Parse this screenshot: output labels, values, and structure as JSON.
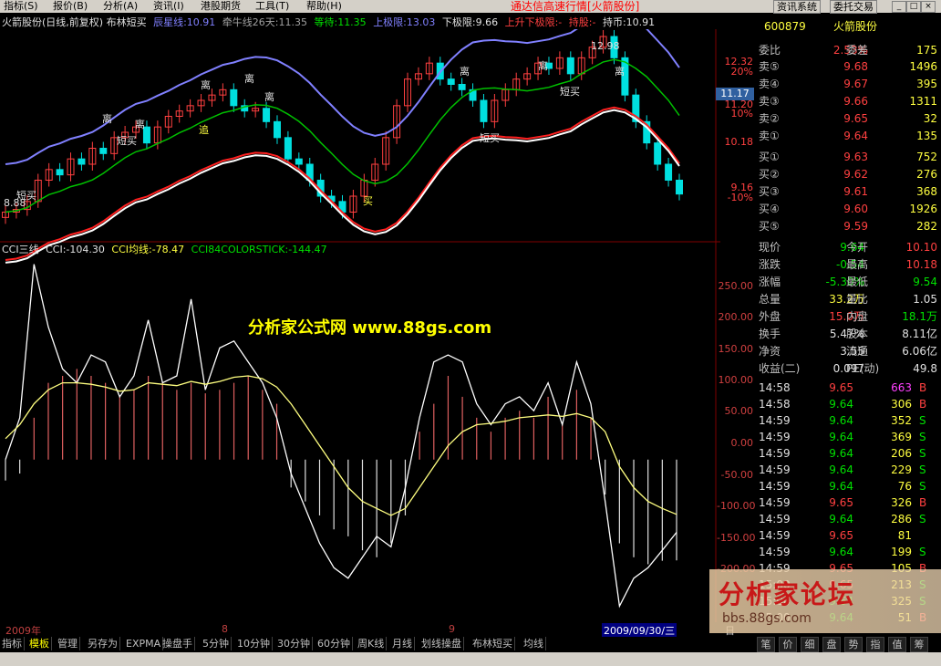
{
  "menubar": {
    "items": [
      "指标(S)",
      "报价(B)",
      "分析(A)",
      "资讯(I)",
      "港股期货",
      "工具(T)",
      "帮助(H)"
    ],
    "title": "通达信高速行情[火箭股份]",
    "buttons": [
      "资讯系统",
      "委托交易"
    ],
    "window_buttons": [
      "_",
      "□",
      "×"
    ]
  },
  "chart_header": {
    "name": "火箭股份(日线,前复权) 布林短买",
    "chenxing": "辰星线:10.91",
    "qianniu": "牵牛线26天:11.35",
    "dengdai": "等待:11.35",
    "upper": "上极限:13.03",
    "lower": "下极限:9.66",
    "updown": "上升下极限:-",
    "hold": "持股:-",
    "coin": "持币:10.91"
  },
  "price_axis": {
    "labels": [
      "12.32",
      "20%",
      "11.20",
      "10%",
      "10.18",
      "9.16",
      "-10%"
    ],
    "current_price_tag": "11.17"
  },
  "cci_header": {
    "name": "CCI三线",
    "cci": "CCI:-104.30",
    "cci_avg": "CCI均线:-78.47",
    "colorstick": "CCI84COLORSTICK:-144.47"
  },
  "cci_axis": [
    "250.00",
    "200.00",
    "150.00",
    "100.00",
    "50.00",
    "0.00",
    "-50.00",
    "-100.00",
    "-150.00",
    "-200.00"
  ],
  "annotations": {
    "li": "离",
    "duanmai": "短买",
    "zhui": "追",
    "mai": "买",
    "high_price": "12.98",
    "low_price": "8.88"
  },
  "watermark": "分析家公式网 www.88gs.com",
  "dates": [
    "2009年",
    "8",
    "9",
    "2009/09/30/三"
  ],
  "period_label": "日线",
  "stock": {
    "code": "600879",
    "name": "火箭股份",
    "weibi_label": "委比",
    "weibi": "2.53%",
    "weicha_label": "委差",
    "weicha": "175"
  },
  "sell_orders": [
    {
      "label": "卖⑤",
      "price": "9.68",
      "vol": "1496"
    },
    {
      "label": "卖④",
      "price": "9.67",
      "vol": "395"
    },
    {
      "label": "卖③",
      "price": "9.66",
      "vol": "1311"
    },
    {
      "label": "卖②",
      "price": "9.65",
      "vol": "32"
    },
    {
      "label": "卖①",
      "price": "9.64",
      "vol": "135"
    }
  ],
  "buy_orders": [
    {
      "label": "买①",
      "price": "9.63",
      "vol": "752"
    },
    {
      "label": "买②",
      "price": "9.62",
      "vol": "276"
    },
    {
      "label": "买③",
      "price": "9.61",
      "vol": "368"
    },
    {
      "label": "买④",
      "price": "9.60",
      "vol": "1926"
    },
    {
      "label": "买⑤",
      "price": "9.59",
      "vol": "282"
    }
  ],
  "quote": [
    {
      "l1": "现价",
      "v1": "9.64",
      "l2": "今开",
      "v2": "10.10"
    },
    {
      "l1": "涨跌",
      "v1": "-0.54",
      "l2": "最高",
      "v2": "10.18"
    },
    {
      "l1": "涨幅",
      "v1": "-5.30%",
      "l2": "最低",
      "v2": "9.54"
    },
    {
      "l1": "总量",
      "v1": "33.2万",
      "l2": "量比",
      "v2": "1.05"
    },
    {
      "l1": "外盘",
      "v1": "15.0万",
      "l2": "内盘",
      "v2": "18.1万"
    },
    {
      "l1": "换手",
      "v1": "5.47%",
      "l2": "股本",
      "v2": "8.11亿"
    },
    {
      "l1": "净资",
      "v1": "3.55",
      "l2": "流通",
      "v2": "6.06亿"
    },
    {
      "l1": "收益(二)",
      "v1": "0.097",
      "l2": "PE(动)",
      "v2": "49.8"
    }
  ],
  "ticks": [
    {
      "time": "14:58",
      "price": "9.65",
      "vol": "663",
      "bs": "B"
    },
    {
      "time": "14:58",
      "price": "9.64",
      "vol": "306",
      "bs": "B"
    },
    {
      "time": "14:59",
      "price": "9.64",
      "vol": "352",
      "bs": "S"
    },
    {
      "time": "14:59",
      "price": "9.64",
      "vol": "369",
      "bs": "S"
    },
    {
      "time": "14:59",
      "price": "9.64",
      "vol": "206",
      "bs": "S"
    },
    {
      "time": "14:59",
      "price": "9.64",
      "vol": "229",
      "bs": "S"
    },
    {
      "time": "14:59",
      "price": "9.64",
      "vol": "76",
      "bs": "S"
    },
    {
      "time": "14:59",
      "price": "9.65",
      "vol": "326",
      "bs": "B"
    },
    {
      "time": "14:59",
      "price": "9.64",
      "vol": "286",
      "bs": "S"
    },
    {
      "time": "14:59",
      "price": "9.65",
      "vol": "81",
      "bs": ""
    },
    {
      "time": "14:59",
      "price": "9.64",
      "vol": "199",
      "bs": "S"
    },
    {
      "time": "14:59",
      "price": "9.65",
      "vol": "105",
      "bs": "B"
    },
    {
      "time": "15:00",
      "price": "9.65",
      "vol": "213",
      "bs": "S"
    },
    {
      "time": "15:00",
      "price": "9.64",
      "vol": "325",
      "bs": "S"
    },
    {
      "time": "15:00",
      "price": "9.64",
      "vol": "51",
      "bs": "B"
    }
  ],
  "tabs": [
    "指标",
    "模板",
    "管理",
    "另存为",
    "EXPMA",
    "操盘手",
    "5分钟",
    "10分钟",
    "30分钟",
    "60分钟",
    "周K线",
    "月线",
    "划线操盘",
    "布林短买",
    "均线"
  ],
  "right_tabs": [
    "笔",
    "价",
    "细",
    "盘",
    "势",
    "指",
    "值",
    "筹"
  ],
  "logo": {
    "text": "分析家论坛",
    "url": "bbs.88gs.com"
  },
  "colors": {
    "up": "#ff4040",
    "down": "#00e0e0",
    "bg": "#000000",
    "grid": "#800000"
  },
  "chart_data": [
    {
      "type": "candlestick",
      "title": "火箭股份(日线,前复权) 布林短买",
      "ylim": [
        9.0,
        12.6
      ],
      "closes": [
        9.3,
        9.35,
        9.5,
        9.9,
        10.1,
        10.0,
        10.3,
        10.2,
        10.5,
        10.4,
        10.7,
        10.8,
        10.9,
        10.6,
        10.9,
        11.1,
        11.2,
        11.3,
        11.4,
        11.5,
        11.6,
        11.3,
        11.2,
        11.25,
        11.0,
        10.7,
        10.3,
        10.2,
        9.9,
        9.6,
        9.5,
        9.3,
        9.6,
        9.9,
        10.2,
        10.7,
        11.3,
        11.8,
        11.9,
        12.1,
        11.8,
        11.7,
        11.6,
        11.4,
        11.0,
        11.4,
        11.6,
        11.8,
        11.9,
        12.1,
        12.0,
        12.2,
        11.9,
        12.2,
        12.4,
        12.6,
        12.2,
        11.5,
        11.0,
        10.6,
        10.2,
        9.9,
        9.64
      ]
    },
    {
      "type": "line",
      "title": "CCI三线",
      "ylim": [
        -220,
        290
      ],
      "series": [
        {
          "name": "CCI",
          "values": [
            0,
            60,
            280,
            190,
            130,
            110,
            150,
            140,
            90,
            120,
            200,
            110,
            120,
            230,
            100,
            160,
            170,
            140,
            110,
            60,
            -20,
            -70,
            -120,
            -155,
            -170,
            -140,
            -110,
            -125,
            -40,
            60,
            140,
            150,
            140,
            80,
            50,
            80,
            90,
            70,
            110,
            50,
            140,
            80,
            -60,
            -210,
            -170,
            -155,
            -130,
            -104.3
          ]
        },
        {
          "name": "CCI均线",
          "values": [
            30,
            50,
            80,
            100,
            110,
            110,
            108,
            104,
            98,
            100,
            110,
            108,
            106,
            112,
            108,
            112,
            118,
            120,
            116,
            104,
            80,
            50,
            20,
            -10,
            -40,
            -60,
            -70,
            -80,
            -70,
            -40,
            -10,
            20,
            40,
            50,
            52,
            55,
            60,
            62,
            64,
            62,
            66,
            60,
            40,
            -10,
            -40,
            -60,
            -70,
            -78.47
          ]
        },
        {
          "name": "CCI84COLORSTICK",
          "values": [
            -30,
            -20,
            60,
            110,
            120,
            130,
            120,
            110,
            90,
            100,
            120,
            110,
            100,
            110,
            95,
            100,
            110,
            120,
            100,
            80,
            -40,
            -60,
            -80,
            -100,
            -110,
            -130,
            -140,
            -120,
            -80,
            40,
            80,
            120,
            90,
            60,
            40,
            60,
            70,
            60,
            90,
            50,
            100,
            60,
            -50,
            -120,
            -140,
            -150,
            -145,
            -144.47
          ]
        }
      ]
    }
  ]
}
